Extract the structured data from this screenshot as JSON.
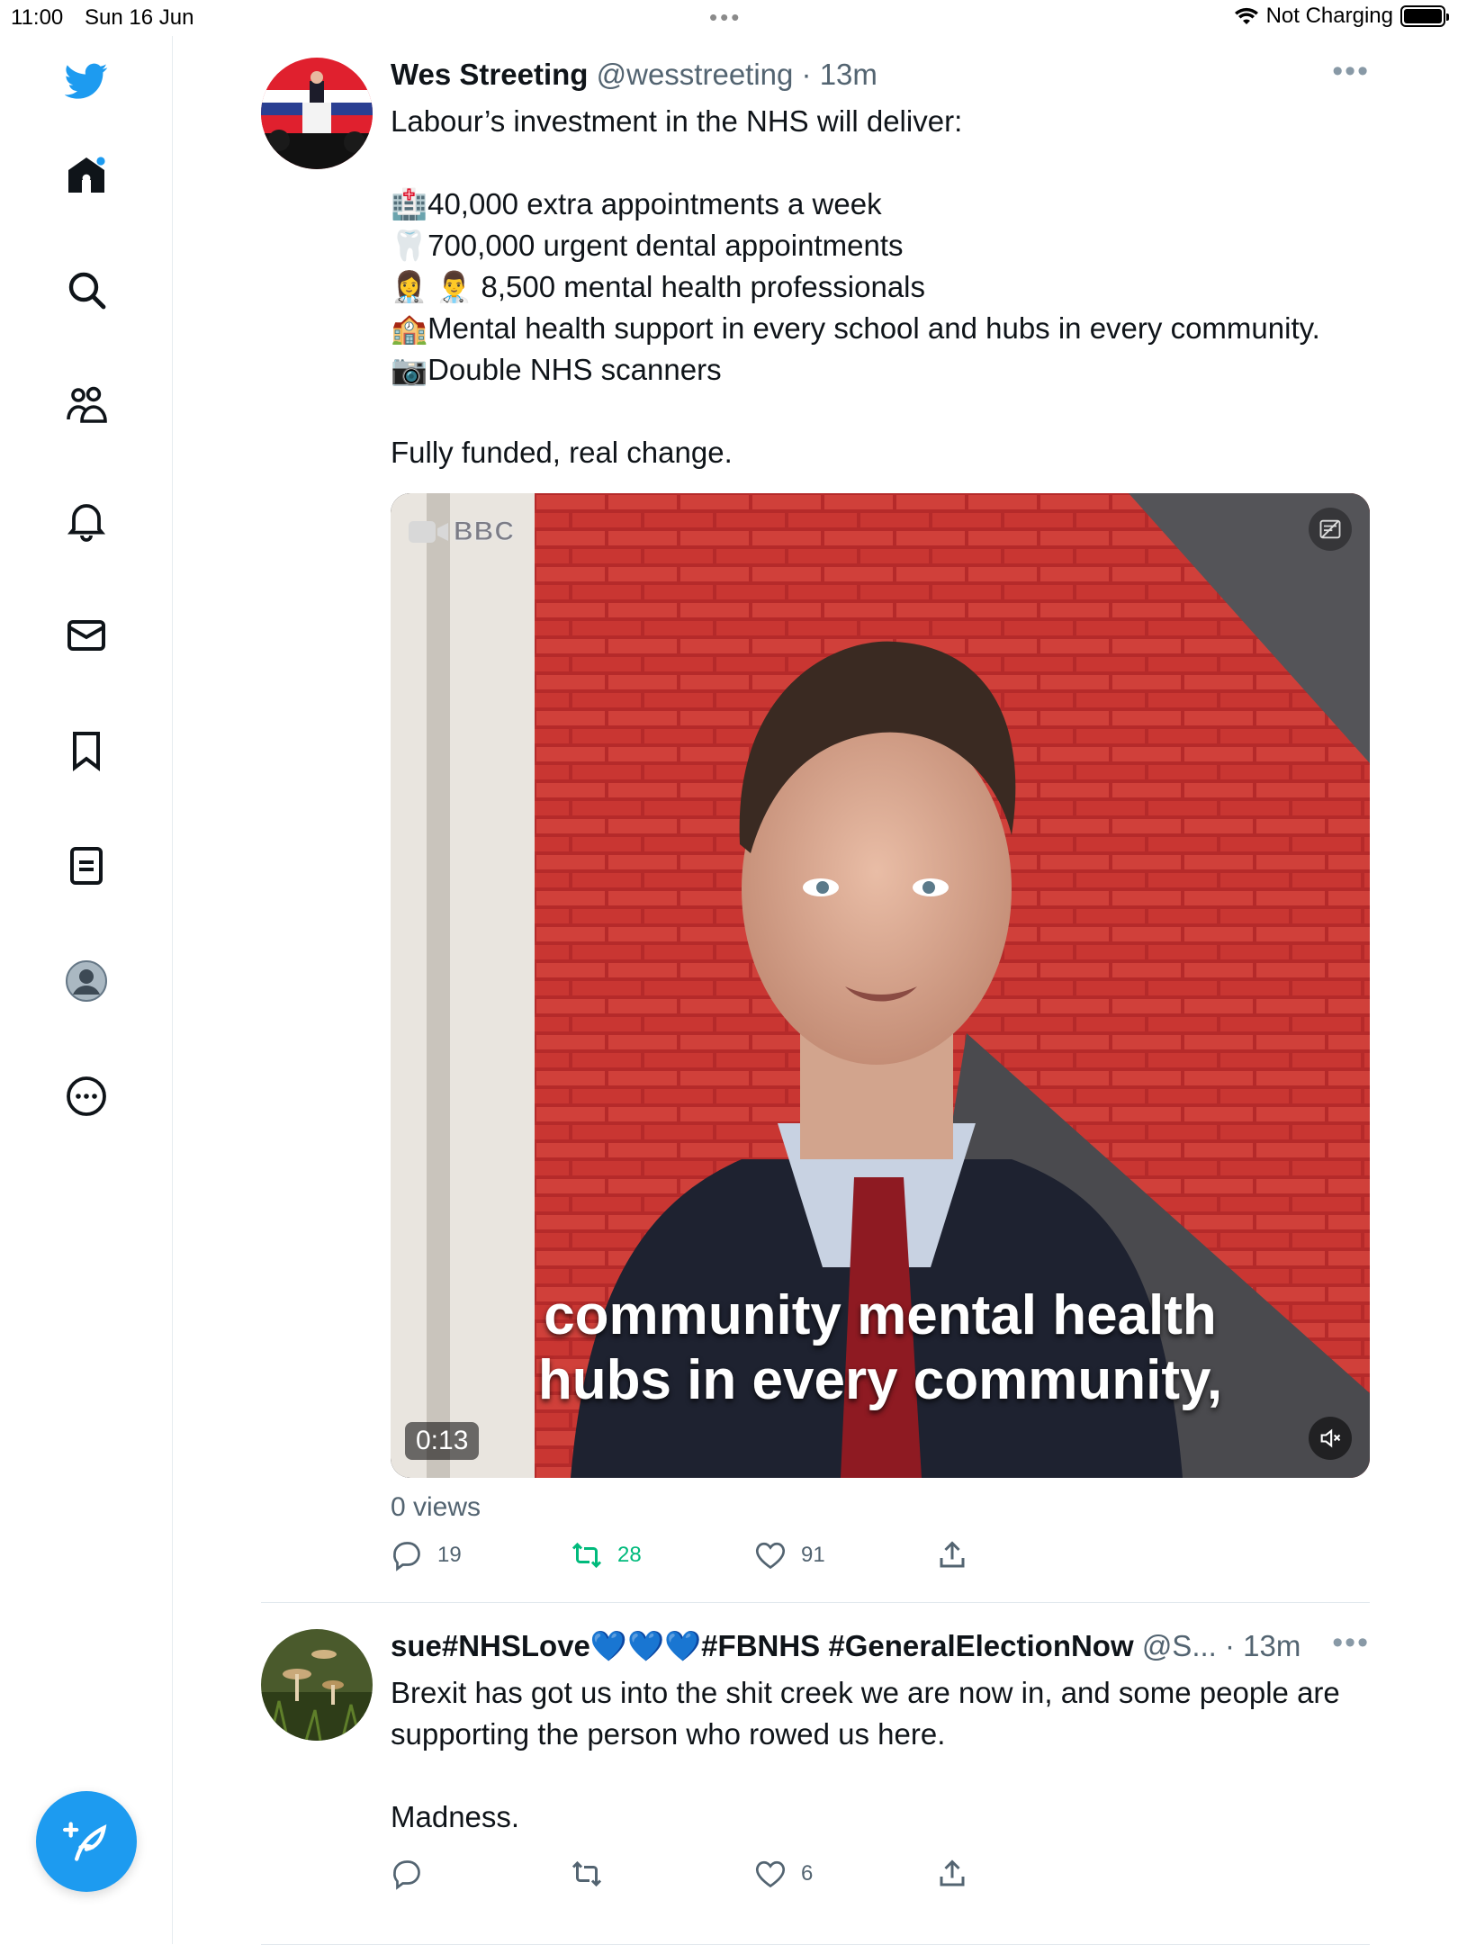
{
  "status_bar": {
    "time": "11:00",
    "date": "Sun 16 Jun",
    "charging": "Not Charging"
  },
  "sidebar": {
    "items": [
      "home",
      "explore",
      "communities",
      "notifications",
      "messages",
      "bookmarks",
      "lists",
      "profile",
      "more"
    ],
    "home_has_notification_dot": true
  },
  "tweets": [
    {
      "name": "Wes Streeting",
      "meta": "@wesstreeting · 13m",
      "text": "Labour’s investment in the NHS will deliver:\n\n🏥40,000 extra appointments a week\n🦷700,000 urgent dental appointments\n👩‍⚕️ 👨‍⚕️ 8,500 mental health professionals\n🏫Mental health support in every school and hubs in every community.\n📷Double NHS scanners\n\nFully funded, real change.",
      "video": {
        "source_label": "BBC",
        "caption_line1": "community mental health",
        "caption_line2": "hubs in every community,",
        "duration": "0:13"
      },
      "views": "0 views",
      "replies": "19",
      "retweets": "28",
      "likes": "91"
    },
    {
      "name": "sue#NHSLove💙💙💙#FBNHS #GeneralElectionNow",
      "meta": "@S... · 13m",
      "text": "Brexit has got us into the shit creek we are now in, and some people are supporting the person who rowed us here.\n\nMadness.",
      "replies": "",
      "retweets": "",
      "likes": "6"
    }
  ],
  "colors": {
    "accent": "#1d9bf0",
    "retweeted": "#00ba7c",
    "secondary_text": "#536471"
  }
}
